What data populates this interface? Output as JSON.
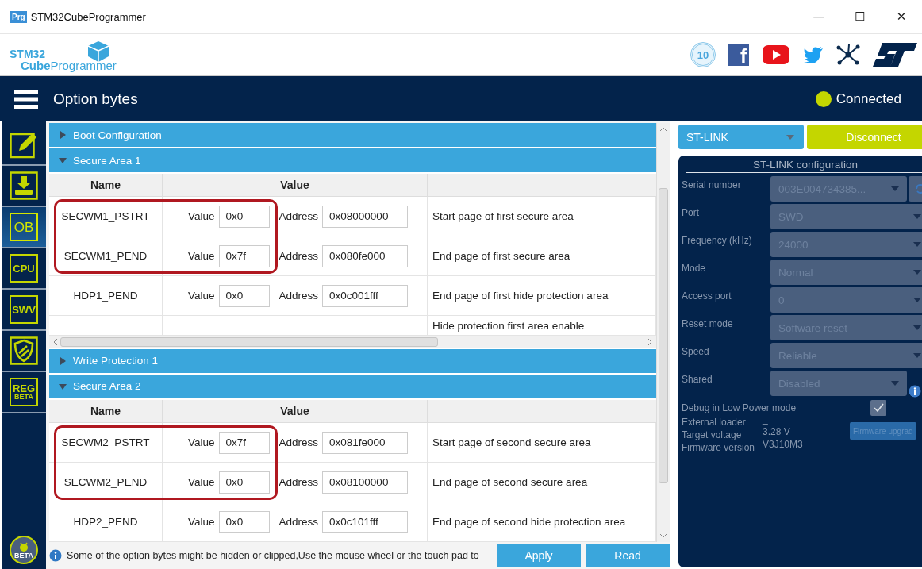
{
  "window": {
    "app_icon": "Prg",
    "title": "STM32CubeProgrammer",
    "controls": [
      "—",
      "☐",
      "✕"
    ]
  },
  "logo": {
    "line1": "STM32",
    "line2": "**Cube**Programmer"
  },
  "social": [
    {
      "kind": "anniversary",
      "text": "10"
    },
    {
      "kind": "facebook",
      "text": "f"
    },
    {
      "kind": "youtube"
    },
    {
      "kind": "twitter"
    },
    {
      "kind": "network"
    },
    {
      "kind": "st"
    }
  ],
  "header": {
    "title": "Option bytes",
    "status": {
      "label": "Connected",
      "connected": true
    }
  },
  "sidebar": [
    {
      "kind": "edit",
      "selected": false
    },
    {
      "kind": "download",
      "selected": false
    },
    {
      "kind": "text",
      "label": "OB",
      "selected": true
    },
    {
      "kind": "text",
      "label": "CPU",
      "selected": false
    },
    {
      "kind": "text",
      "label": "SWV",
      "selected": false
    },
    {
      "kind": "shield",
      "selected": false
    },
    {
      "kind": "text",
      "label": "REG",
      "sub": "BETA",
      "selected": false
    }
  ],
  "beta_button": {
    "label": "BETA"
  },
  "sections": [
    {
      "title": "Boot Configuration",
      "expanded": false
    },
    {
      "title": "Secure Area 1",
      "expanded": true,
      "columns": [
        "Name",
        "Value"
      ],
      "h_scrollbar": true,
      "rows": [
        {
          "kind": "field",
          "name": "SECWM1_PSTRT",
          "value_label": "Value",
          "value": "0x0",
          "address_label": "Address",
          "address": "0x08000000",
          "description": "Start page of first secure area",
          "highlighted": true
        },
        {
          "kind": "field",
          "name": "SECWM1_PEND",
          "value_label": "Value",
          "value": "0x7f",
          "address_label": "Address",
          "address": "0x080fe000",
          "description": "End page of first secure area",
          "highlighted": true
        },
        {
          "kind": "field",
          "name": "HDP1_PEND",
          "value_label": "Value",
          "value": "0x0",
          "address_label": "Address",
          "address": "0x0c001fff",
          "description": "End page of first hide protection area",
          "highlighted": false
        },
        {
          "kind": "note",
          "description": "Hide protection first area enable",
          "highlighted": false
        }
      ]
    },
    {
      "title": "Write Protection 1",
      "expanded": false
    },
    {
      "title": "Secure Area 2",
      "expanded": true,
      "columns": [
        "Name",
        "Value"
      ],
      "rows": [
        {
          "kind": "field",
          "name": "SECWM2_PSTRT",
          "value_label": "Value",
          "value": "0x7f",
          "address_label": "Address",
          "address": "0x081fe000",
          "description": "Start page of second secure area",
          "highlighted": true
        },
        {
          "kind": "field",
          "name": "SECWM2_PEND",
          "value_label": "Value",
          "value": "0x0",
          "address_label": "Address",
          "address": "0x08100000",
          "description": "End page of second secure area",
          "highlighted": true
        },
        {
          "kind": "field",
          "name": "HDP2_PEND",
          "value_label": "Value",
          "value": "0x0",
          "address_label": "Address",
          "address": "0x0c101fff",
          "description": "End page of second hide protection area",
          "highlighted": false
        }
      ]
    }
  ],
  "footer": {
    "message": "Some of the option bytes might be hidden or clipped,Use the mouse wheel or the touch pad to",
    "buttons": [
      "Apply",
      "Read"
    ]
  },
  "connection": {
    "interface": "ST-LINK",
    "action": "Disconnect",
    "config": {
      "title": "ST-LINK configuration",
      "disabled": true,
      "fields": [
        {
          "kind": "serial",
          "label": "Serial number",
          "value": "003E004734385..."
        },
        {
          "kind": "select",
          "label": "Port",
          "value": "SWD"
        },
        {
          "kind": "select",
          "label": "Frequency (kHz)",
          "value": "24000"
        },
        {
          "kind": "select",
          "label": "Mode",
          "value": "Normal"
        },
        {
          "kind": "select",
          "label": "Access port",
          "value": "0"
        },
        {
          "kind": "select",
          "label": "Reset mode",
          "value": "Software reset"
        },
        {
          "kind": "select",
          "label": "Speed",
          "value": "Reliable"
        },
        {
          "kind": "select_info",
          "label": "Shared",
          "value": "Disabled"
        }
      ],
      "debug_low_power": {
        "label": "Debug in Low Power mode",
        "checked": true
      },
      "info": [
        {
          "label": "External loader",
          "value": "_"
        },
        {
          "label": "Target voltage",
          "value": "3.28 V"
        },
        {
          "label": "Firmware version",
          "value": "V3J10M3"
        }
      ],
      "upgrade_button": {
        "label": "Firmware upgrad",
        "disabled": true
      }
    }
  }
}
